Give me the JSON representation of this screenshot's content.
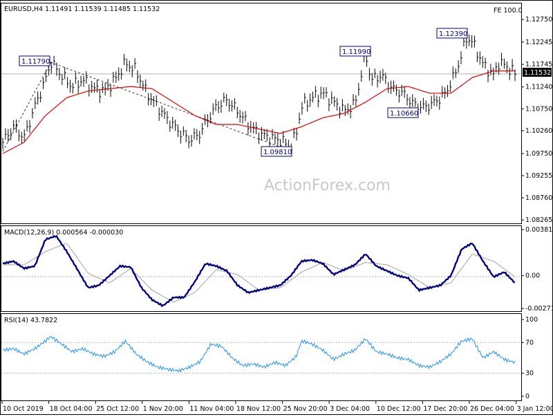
{
  "header": {
    "symbol_line": "EURUSD,H4  1.11491 1.11539 1.11485 1.11532",
    "fe_label": "FE 100.0"
  },
  "watermark": "ActionForex.com",
  "colors": {
    "bars": "#000000",
    "moving_average": "#e00000",
    "macd_line": "#000080",
    "macd_signal": "#a0a0a0",
    "rsi_line": "#1e90ff",
    "trend_line": "#000000",
    "label_border": "#000080"
  },
  "chart_data": [
    {
      "type": "line",
      "name": "price",
      "ylim": [
        1.08265,
        1.13
      ],
      "y_ticks": [
        "1.12750",
        "1.12245",
        "1.11745",
        "1.11240",
        "1.10750",
        "1.10260",
        "1.09750",
        "1.09255",
        "1.08760",
        "1.08265"
      ],
      "current_price_label": "1.11532",
      "x_tick_labels": [
        "10 Oct 2019",
        "18 Oct 04:00",
        "25 Oct 12:00",
        "1 Nov 20:00",
        "11 Nov 04:00",
        "18 Nov 12:00",
        "25 Nov 20:00",
        "3 Dec 04:00",
        "10 Dec 12:00",
        "17 Dec 20:00",
        "26 Dec 04:00",
        "3 Jan 12:00"
      ],
      "price_path": [
        [
          0,
          1.1
        ],
        [
          2,
          1.1035
        ],
        [
          4,
          1.101
        ],
        [
          6,
          1.108
        ],
        [
          8,
          1.114
        ],
        [
          9,
          1.118
        ],
        [
          11,
          1.115
        ],
        [
          13,
          1.1125
        ],
        [
          15,
          1.114
        ],
        [
          17,
          1.112
        ],
        [
          19,
          1.1115
        ],
        [
          21,
          1.114
        ],
        [
          23,
          1.1178
        ],
        [
          25,
          1.116
        ],
        [
          27,
          1.111
        ],
        [
          29,
          1.108
        ],
        [
          31,
          1.105
        ],
        [
          33,
          1.1025
        ],
        [
          35,
          1.1005
        ],
        [
          37,
          1.102
        ],
        [
          38,
          1.1045
        ],
        [
          40,
          1.108
        ],
        [
          42,
          1.1095
        ],
        [
          44,
          1.107
        ],
        [
          46,
          1.104
        ],
        [
          48,
          1.102
        ],
        [
          50,
          1.101
        ],
        [
          52,
          1.1005
        ],
        [
          54,
          1.099
        ],
        [
          55,
          1.102
        ],
        [
          56,
          1.108
        ],
        [
          58,
          1.11
        ],
        [
          60,
          1.111
        ],
        [
          62,
          1.109
        ],
        [
          64,
          1.107
        ],
        [
          66,
          1.1085
        ],
        [
          67,
          1.114
        ],
        [
          68,
          1.1199
        ],
        [
          69,
          1.114
        ],
        [
          71,
          1.115
        ],
        [
          73,
          1.112
        ],
        [
          75,
          1.111
        ],
        [
          77,
          1.1085
        ],
        [
          79,
          1.1078
        ],
        [
          81,
          1.109
        ],
        [
          83,
          1.111
        ],
        [
          85,
          1.116
        ],
        [
          87,
          1.1235
        ],
        [
          88,
          1.1225
        ],
        [
          90,
          1.1175
        ],
        [
          92,
          1.115
        ],
        [
          93,
          1.118
        ],
        [
          95,
          1.1165
        ],
        [
          96,
          1.1153
        ]
      ],
      "moving_average_path": [
        [
          0,
          1.0975
        ],
        [
          4,
          1.1
        ],
        [
          8,
          1.106
        ],
        [
          12,
          1.11
        ],
        [
          16,
          1.1115
        ],
        [
          20,
          1.112
        ],
        [
          24,
          1.1125
        ],
        [
          28,
          1.112
        ],
        [
          32,
          1.109
        ],
        [
          36,
          1.106
        ],
        [
          40,
          1.104
        ],
        [
          44,
          1.104
        ],
        [
          48,
          1.103
        ],
        [
          52,
          1.102
        ],
        [
          56,
          1.1035
        ],
        [
          60,
          1.1055
        ],
        [
          64,
          1.1065
        ],
        [
          68,
          1.109
        ],
        [
          72,
          1.112
        ],
        [
          76,
          1.1125
        ],
        [
          80,
          1.111
        ],
        [
          84,
          1.111
        ],
        [
          88,
          1.1145
        ],
        [
          92,
          1.116
        ],
        [
          96,
          1.116
        ]
      ],
      "annotations": [
        "1.11790",
        "1.09810",
        "1.11990",
        "1.10660",
        "1.12390"
      ]
    },
    {
      "type": "line",
      "name": "MACD(12,26,9) 0.000564 -0.000030",
      "ylim": [
        -0.002713,
        0.003819
      ],
      "y_ticks": [
        "0.003819",
        "0.00",
        "-0.002713"
      ],
      "macd_path": [
        [
          0,
          0.001
        ],
        [
          2,
          0.0012
        ],
        [
          4,
          0.0006
        ],
        [
          6,
          0.0008
        ],
        [
          8,
          0.003
        ],
        [
          10,
          0.0033
        ],
        [
          12,
          0.002
        ],
        [
          14,
          0.0005
        ],
        [
          16,
          -0.001
        ],
        [
          18,
          -0.0008
        ],
        [
          20,
          0.0
        ],
        [
          22,
          0.0008
        ],
        [
          24,
          0.0007
        ],
        [
          26,
          -0.001
        ],
        [
          28,
          -0.002
        ],
        [
          30,
          -0.0025
        ],
        [
          32,
          -0.0018
        ],
        [
          34,
          -0.0018
        ],
        [
          36,
          -0.0005
        ],
        [
          38,
          0.001
        ],
        [
          40,
          0.0008
        ],
        [
          42,
          0.0004
        ],
        [
          44,
          -0.0008
        ],
        [
          46,
          -0.0014
        ],
        [
          48,
          -0.0012
        ],
        [
          50,
          -0.001
        ],
        [
          52,
          -0.0008
        ],
        [
          54,
          0.0
        ],
        [
          56,
          0.0012
        ],
        [
          58,
          0.0013
        ],
        [
          60,
          0.001
        ],
        [
          62,
          0.0001
        ],
        [
          64,
          0.0005
        ],
        [
          66,
          0.0009
        ],
        [
          68,
          0.0018
        ],
        [
          70,
          0.0008
        ],
        [
          72,
          0.0004
        ],
        [
          74,
          0.0
        ],
        [
          76,
          -0.0002
        ],
        [
          78,
          -0.0012
        ],
        [
          80,
          -0.001
        ],
        [
          82,
          -0.0008
        ],
        [
          84,
          0.0
        ],
        [
          86,
          0.0022
        ],
        [
          88,
          0.0027
        ],
        [
          90,
          0.0012
        ],
        [
          92,
          -0.0001
        ],
        [
          94,
          0.0003
        ],
        [
          96,
          -0.0006
        ]
      ],
      "signal_path": [
        [
          0,
          0.0009
        ],
        [
          4,
          0.0009
        ],
        [
          8,
          0.002
        ],
        [
          12,
          0.0027
        ],
        [
          16,
          0.0002
        ],
        [
          20,
          -0.0006
        ],
        [
          24,
          0.0006
        ],
        [
          28,
          -0.0012
        ],
        [
          32,
          -0.0022
        ],
        [
          36,
          -0.0014
        ],
        [
          40,
          0.0005
        ],
        [
          44,
          0.0001
        ],
        [
          48,
          -0.0012
        ],
        [
          52,
          -0.001
        ],
        [
          56,
          0.0003
        ],
        [
          60,
          0.0011
        ],
        [
          64,
          0.0004
        ],
        [
          68,
          0.0011
        ],
        [
          72,
          0.0009
        ],
        [
          76,
          0.0001
        ],
        [
          80,
          -0.001
        ],
        [
          84,
          -0.0006
        ],
        [
          88,
          0.0018
        ],
        [
          92,
          0.0012
        ],
        [
          96,
          -0.0001
        ]
      ]
    },
    {
      "type": "line",
      "name": "RSI(14) 43.7822",
      "ylim": [
        0,
        100
      ],
      "y_ticks": [
        "100",
        "70",
        "30",
        "0"
      ],
      "levels": [
        70,
        30
      ],
      "rsi_path": [
        [
          0,
          60
        ],
        [
          2,
          62
        ],
        [
          4,
          55
        ],
        [
          6,
          62
        ],
        [
          8,
          72
        ],
        [
          9,
          78
        ],
        [
          11,
          68
        ],
        [
          13,
          58
        ],
        [
          15,
          62
        ],
        [
          17,
          55
        ],
        [
          19,
          52
        ],
        [
          21,
          58
        ],
        [
          23,
          72
        ],
        [
          25,
          55
        ],
        [
          27,
          45
        ],
        [
          29,
          38
        ],
        [
          31,
          35
        ],
        [
          33,
          33
        ],
        [
          35,
          38
        ],
        [
          37,
          45
        ],
        [
          39,
          68
        ],
        [
          41,
          65
        ],
        [
          43,
          50
        ],
        [
          45,
          40
        ],
        [
          47,
          42
        ],
        [
          49,
          38
        ],
        [
          51,
          44
        ],
        [
          53,
          40
        ],
        [
          55,
          52
        ],
        [
          56,
          72
        ],
        [
          58,
          68
        ],
        [
          60,
          60
        ],
        [
          62,
          48
        ],
        [
          64,
          55
        ],
        [
          66,
          60
        ],
        [
          68,
          75
        ],
        [
          70,
          58
        ],
        [
          72,
          55
        ],
        [
          74,
          50
        ],
        [
          76,
          48
        ],
        [
          78,
          40
        ],
        [
          80,
          38
        ],
        [
          82,
          45
        ],
        [
          84,
          55
        ],
        [
          86,
          72
        ],
        [
          88,
          75
        ],
        [
          90,
          50
        ],
        [
          92,
          58
        ],
        [
          94,
          48
        ],
        [
          96,
          44
        ]
      ]
    }
  ]
}
